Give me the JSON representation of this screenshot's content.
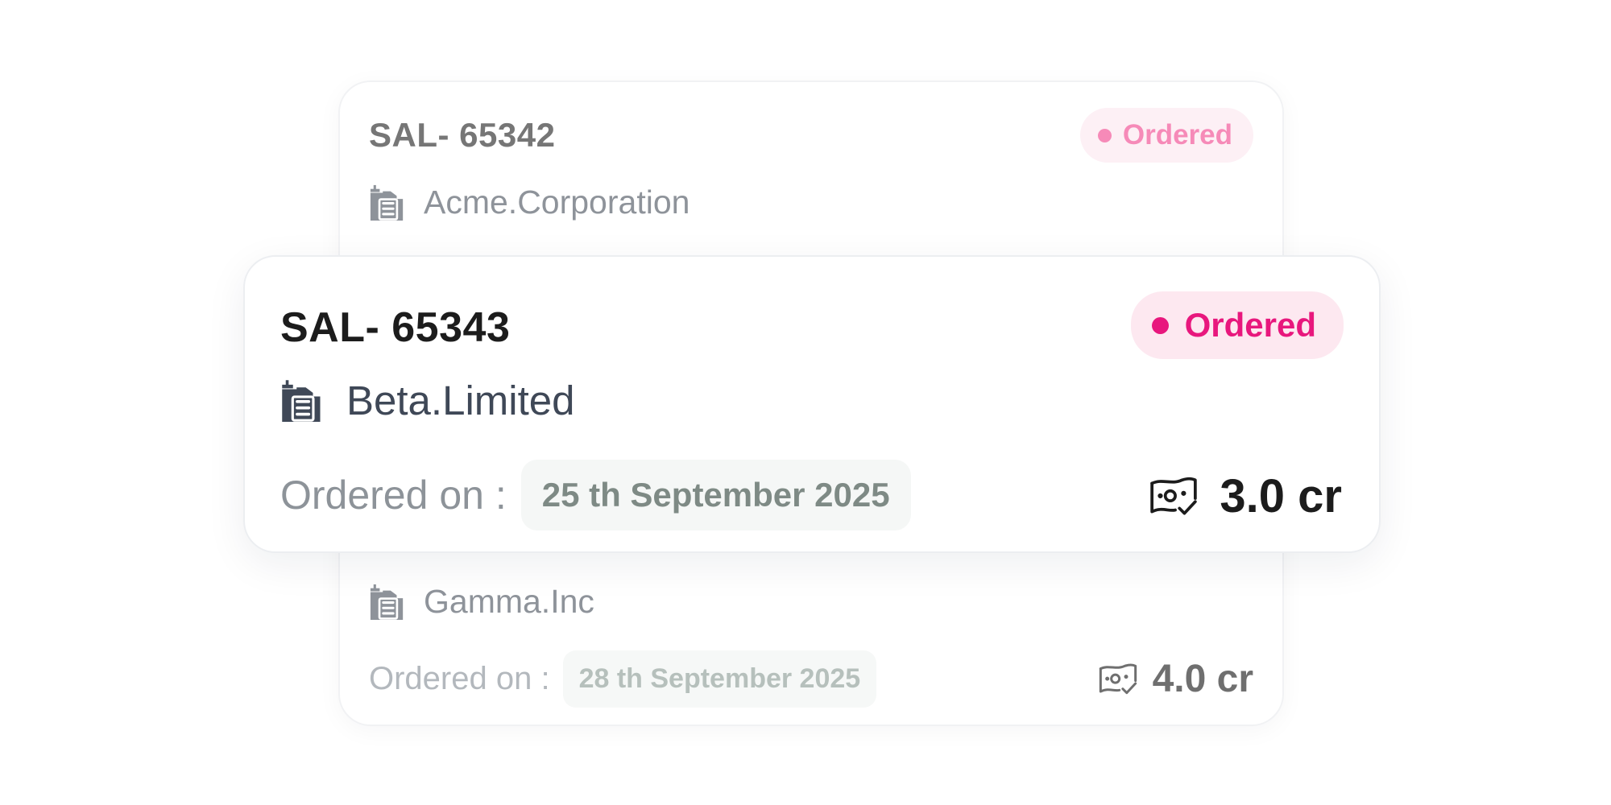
{
  "cards": {
    "back": {
      "top": {
        "order_id": "SAL- 65342",
        "status": "Ordered",
        "company": "Acme.Corporation",
        "company_icon": "building-icon"
      },
      "bottom": {
        "company": "Gamma.Inc",
        "company_icon": "building-icon",
        "ordered_label": "Ordered on :",
        "ordered_date": "28 th September 2025",
        "amount": "4.0 cr",
        "amount_icon": "money-verified-icon"
      }
    },
    "front": {
      "order_id": "SAL- 65343",
      "status": "Ordered",
      "company": "Beta.Limited",
      "company_icon": "building-icon",
      "ordered_label": "Ordered on :",
      "ordered_date": "25 th September 2025",
      "amount": "3.0 cr",
      "amount_icon": "money-verified-icon"
    }
  },
  "colors": {
    "status_pink": "#e8177d",
    "status_pink_bg": "#fde8f0",
    "status_pink_faded": "#f68ab8",
    "text_dark": "#1c1c1c",
    "company_slate": "#3f4857"
  }
}
